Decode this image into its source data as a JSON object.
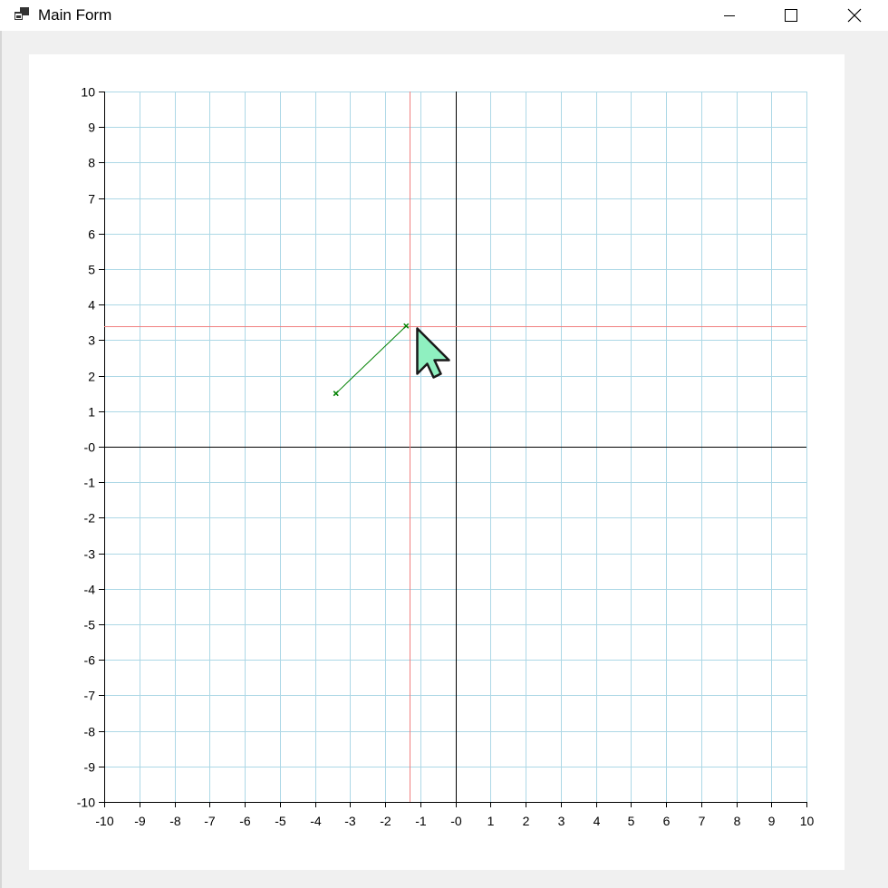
{
  "window": {
    "title": "Main Form",
    "icons": {
      "app": "app-form-icon",
      "minimize": "minimize-icon",
      "maximize": "maximize-icon",
      "close": "close-icon"
    }
  },
  "canvas": {
    "icons": {
      "cursor": "mouse-pointer-icon"
    },
    "colors": {
      "grid": "#add8e6",
      "axes": "#000000",
      "crosshair": "#f08080",
      "segment": "#008000",
      "cursor_fill": "#8ff0c0"
    }
  },
  "chart_data": {
    "type": "scatter",
    "xlim": [
      -10,
      10
    ],
    "ylim": [
      -10,
      10
    ],
    "x_ticks": [
      "-10",
      "-9",
      "-8",
      "-7",
      "-6",
      "-5",
      "-4",
      "-3",
      "-2",
      "-1",
      "-0",
      "1",
      "2",
      "3",
      "4",
      "5",
      "6",
      "7",
      "8",
      "9",
      "10"
    ],
    "y_ticks": [
      "-10",
      "-9",
      "-8",
      "-7",
      "-6",
      "-5",
      "-4",
      "-3",
      "-2",
      "-1",
      "-0",
      "1",
      "2",
      "3",
      "4",
      "5",
      "6",
      "7",
      "8",
      "9",
      "10"
    ],
    "grid": true,
    "segment": {
      "x": [
        -3.4,
        -1.4
      ],
      "y": [
        1.5,
        3.4
      ]
    },
    "crosshair": {
      "x": -1.3,
      "y": 3.4
    }
  }
}
